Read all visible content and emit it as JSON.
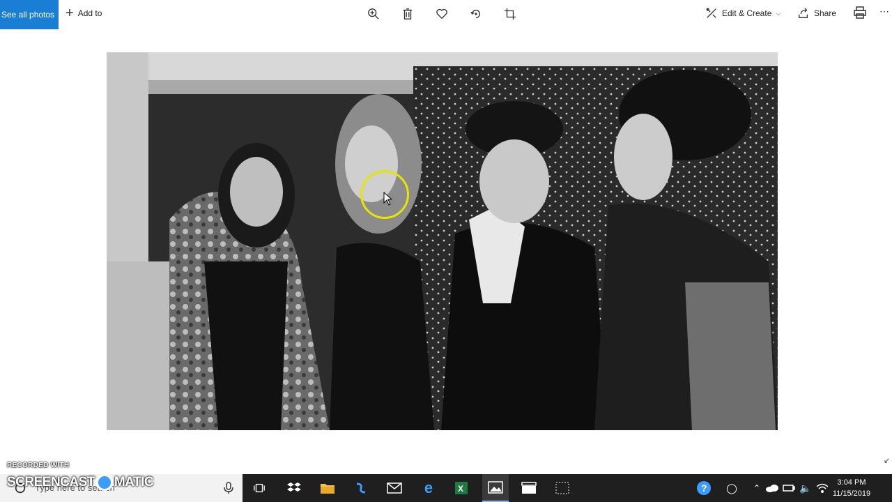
{
  "toolbar": {
    "see_all_photos": "See all photos",
    "add_to": "Add to",
    "edit_create": "Edit & Create",
    "share": "Share",
    "icons": [
      "zoom-in-icon",
      "delete-icon",
      "heart-icon",
      "rotate-icon",
      "crop-icon",
      "edit-create-icon",
      "share-icon",
      "print-icon",
      "more-icon"
    ]
  },
  "watermark": {
    "line1": "RECORDED WITH",
    "line2": "SCREENCAST",
    "line3": "MATIC"
  },
  "taskbar": {
    "search_placeholder": "Type here to search",
    "time": "3:04 PM",
    "date": "11/15/2019"
  },
  "colors": {
    "accent": "#1a7fd4",
    "taskbar": "#1f1f1f",
    "cursor_highlight": "#e6e600"
  }
}
